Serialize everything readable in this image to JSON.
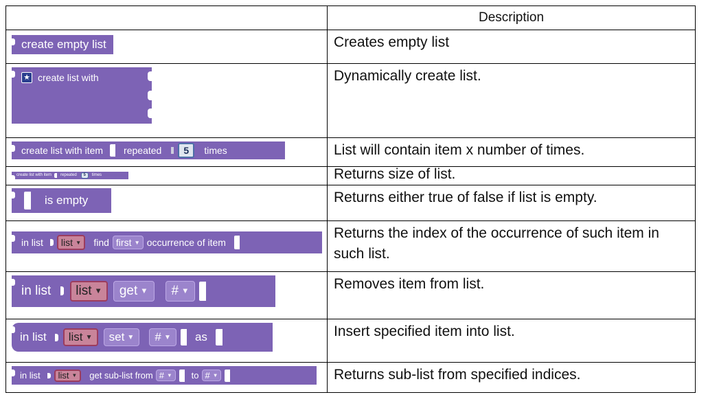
{
  "table": {
    "header": {
      "left": "",
      "right": "Description"
    },
    "rows": [
      {
        "block": {
          "text": "create empty list"
        },
        "description": "Creates empty list"
      },
      {
        "block": {
          "text": "create list with",
          "icon": "gear-star-icon"
        },
        "description": "Dynamically create list."
      },
      {
        "block": {
          "text1": "create list with item",
          "text2": "repeated",
          "num": "5",
          "text3": "times"
        },
        "description": "List will contain item x number of times."
      },
      {
        "block": {
          "text1": "create list with item",
          "text2": "repeated",
          "num": "5",
          "text3": "times"
        },
        "description": "Returns size of list."
      },
      {
        "block": {
          "text": "is empty"
        },
        "description": "Returns either true of false if list is empty."
      },
      {
        "block": {
          "text1": "in list",
          "dd1": "list",
          "text2": "find",
          "dd2": "first",
          "text3": "occurrence of item"
        },
        "description": "Returns the index of the occurrence of such item in such list."
      },
      {
        "block": {
          "text1": "in list",
          "dd1": "list",
          "dd2": "get",
          "dd3": "#"
        },
        "description": "Removes item from list."
      },
      {
        "block": {
          "text1": "in list",
          "dd1": "list",
          "dd2": "set",
          "dd3": "#",
          "text2": "as"
        },
        "description": "Insert specified item into list."
      },
      {
        "block": {
          "text1": "in list",
          "dd1": "list",
          "text2": "get sub-list from",
          "dd2": "#",
          "text3": "to",
          "dd3": "#"
        },
        "description": "Returns sub-list from specified indices."
      }
    ]
  }
}
